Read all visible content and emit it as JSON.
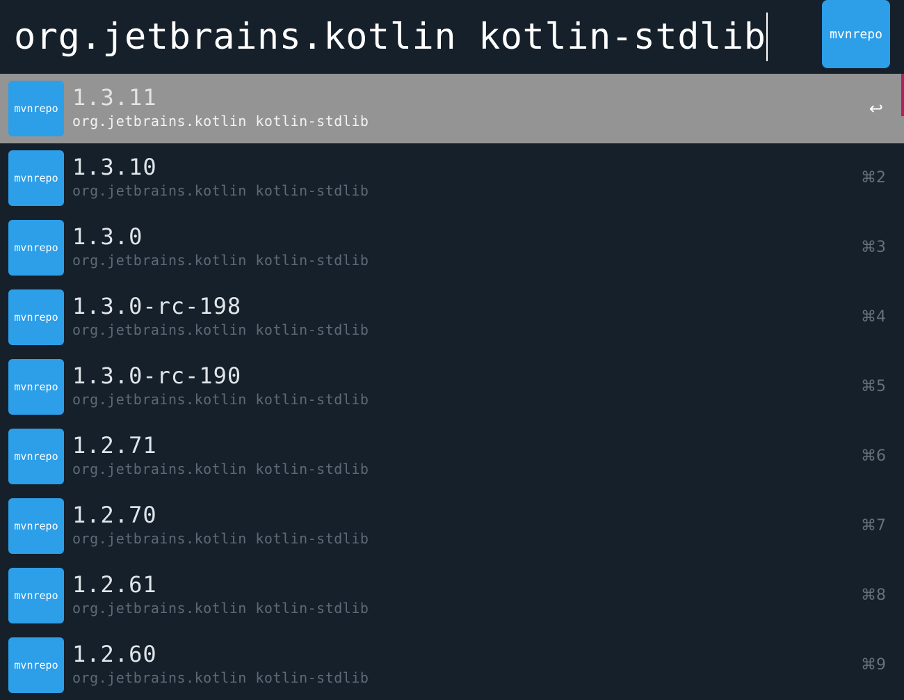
{
  "search": {
    "query": "org.jetbrains.kotlin kotlin-stdlib",
    "source_badge": "mvnrepo"
  },
  "results": [
    {
      "badge": "mvnrepo",
      "version": "1.3.11",
      "coordinates": "org.jetbrains.kotlin kotlin-stdlib",
      "shortcut": "↩",
      "selected": true
    },
    {
      "badge": "mvnrepo",
      "version": "1.3.10",
      "coordinates": "org.jetbrains.kotlin kotlin-stdlib",
      "shortcut": "⌘2",
      "selected": false
    },
    {
      "badge": "mvnrepo",
      "version": "1.3.0",
      "coordinates": "org.jetbrains.kotlin kotlin-stdlib",
      "shortcut": "⌘3",
      "selected": false
    },
    {
      "badge": "mvnrepo",
      "version": "1.3.0-rc-198",
      "coordinates": "org.jetbrains.kotlin kotlin-stdlib",
      "shortcut": "⌘4",
      "selected": false
    },
    {
      "badge": "mvnrepo",
      "version": "1.3.0-rc-190",
      "coordinates": "org.jetbrains.kotlin kotlin-stdlib",
      "shortcut": "⌘5",
      "selected": false
    },
    {
      "badge": "mvnrepo",
      "version": "1.2.71",
      "coordinates": "org.jetbrains.kotlin kotlin-stdlib",
      "shortcut": "⌘6",
      "selected": false
    },
    {
      "badge": "mvnrepo",
      "version": "1.2.70",
      "coordinates": "org.jetbrains.kotlin kotlin-stdlib",
      "shortcut": "⌘7",
      "selected": false
    },
    {
      "badge": "mvnrepo",
      "version": "1.2.61",
      "coordinates": "org.jetbrains.kotlin kotlin-stdlib",
      "shortcut": "⌘8",
      "selected": false
    },
    {
      "badge": "mvnrepo",
      "version": "1.2.60",
      "coordinates": "org.jetbrains.kotlin kotlin-stdlib",
      "shortcut": "⌘9",
      "selected": false
    }
  ],
  "colors": {
    "background": "#15202a",
    "selected_row": "#949494",
    "badge": "#2d9ee8",
    "scroll_indicator": "#b3205a"
  }
}
